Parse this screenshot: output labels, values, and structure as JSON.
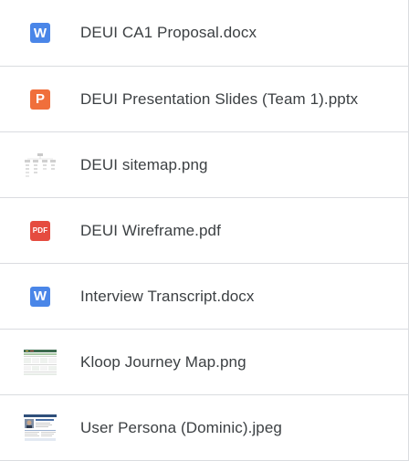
{
  "files": [
    {
      "name": "DEUI CA1 Proposal.docx",
      "icon": "word-icon",
      "badge": "W",
      "color": "#4a86e8"
    },
    {
      "name": "DEUI Presentation Slides (Team 1).pptx",
      "icon": "powerpoint-icon",
      "badge": "P",
      "color": "#f06f3b"
    },
    {
      "name": "DEUI sitemap.png",
      "icon": "sitemap-thumbnail"
    },
    {
      "name": "DEUI Wireframe.pdf",
      "icon": "pdf-icon",
      "badge": "PDF",
      "color": "#e54b3f"
    },
    {
      "name": "Interview Transcript.docx",
      "icon": "word-icon",
      "badge": "W",
      "color": "#4a86e8"
    },
    {
      "name": "Kloop Journey Map.png",
      "icon": "journey-map-thumbnail"
    },
    {
      "name": "User Persona (Dominic).jpeg",
      "icon": "persona-thumbnail"
    }
  ]
}
